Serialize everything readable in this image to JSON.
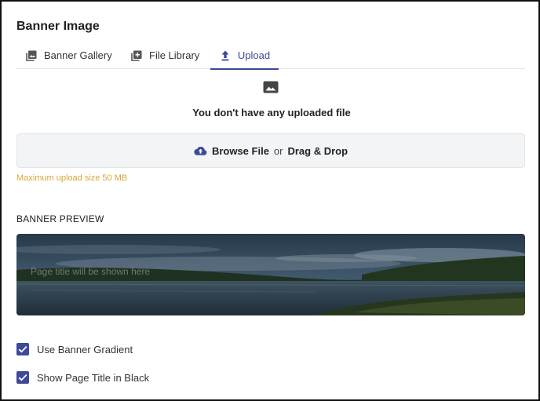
{
  "section": {
    "title": "Banner Image"
  },
  "tabs": [
    {
      "label": "Banner Gallery",
      "icon": "gallery-icon",
      "active": false
    },
    {
      "label": "File Library",
      "icon": "add-box-icon",
      "active": false
    },
    {
      "label": "Upload",
      "icon": "upload-icon",
      "active": true
    }
  ],
  "empty_state": {
    "icon": "image-icon",
    "text": "You don't have any uploaded file"
  },
  "dropzone": {
    "icon": "cloud-upload-icon",
    "browse_label": "Browse File",
    "or_label": "or",
    "drag_label": "Drag & Drop"
  },
  "upload_note": "Maximum upload size 50 MB",
  "preview": {
    "label": "BANNER PREVIEW",
    "page_title_placeholder": "Page title will be shown here"
  },
  "options": [
    {
      "label": "Use Banner Gradient",
      "checked": true
    },
    {
      "label": "Show Page Title in Black",
      "checked": true
    }
  ],
  "colors": {
    "accent": "#3c4a99",
    "note": "#d9a53a",
    "dropzone_bg": "#f3f4f6"
  }
}
